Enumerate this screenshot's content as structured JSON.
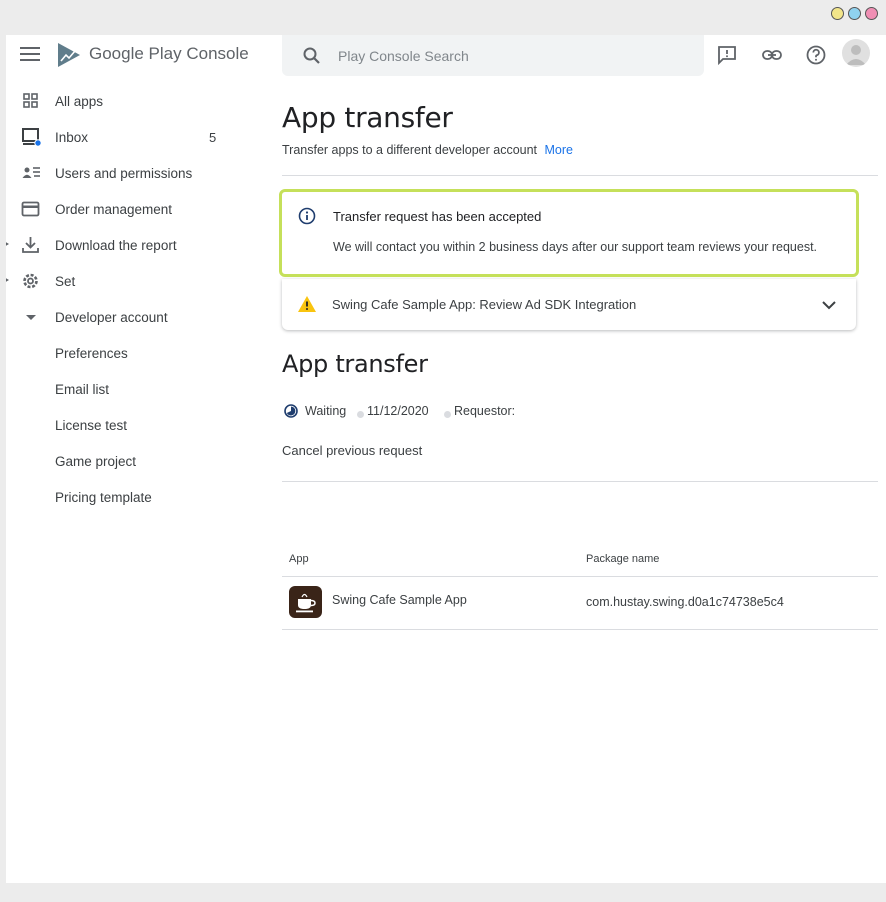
{
  "header": {
    "brand_google_play": "Google Play",
    "brand_console": "Console",
    "search_placeholder": "Play Console Search"
  },
  "sidebar": {
    "items": [
      {
        "label": "All apps",
        "icon": "grid-icon"
      },
      {
        "label": "Inbox",
        "icon": "inbox-icon",
        "count": "5"
      },
      {
        "label": "Users and permissions",
        "icon": "users-icon"
      },
      {
        "label": "Order management",
        "icon": "credit-card-icon"
      },
      {
        "label": "Download the report",
        "icon": "download-icon"
      },
      {
        "label": "Set",
        "icon": "gear-icon"
      },
      {
        "label": "Developer account",
        "icon": "caret-down-icon"
      }
    ],
    "subitems": [
      "Preferences",
      "Email list",
      "License test",
      "Game project",
      "Pricing template"
    ]
  },
  "page": {
    "title": "App transfer",
    "subtitle": "Transfer apps to a different developer account",
    "more_link": "More"
  },
  "alert": {
    "title": "Transfer request has been accepted",
    "message": "We will contact you within 2 business days after our support team reviews your request.",
    "border_color": "#c5e05a"
  },
  "issue": {
    "text": "Swing Cafe Sample App: Review Ad SDK Integration"
  },
  "transfer": {
    "title": "App transfer",
    "status": "Waiting",
    "date": "11/12/2020",
    "requestor_label": "Requestor:",
    "cancel_label": "Cancel previous request"
  },
  "table": {
    "headers": [
      "App",
      "Package name"
    ],
    "rows": [
      {
        "app": "Swing Cafe Sample App",
        "package": "com.hustay.swing.d0a1c74738e5c4"
      }
    ]
  }
}
